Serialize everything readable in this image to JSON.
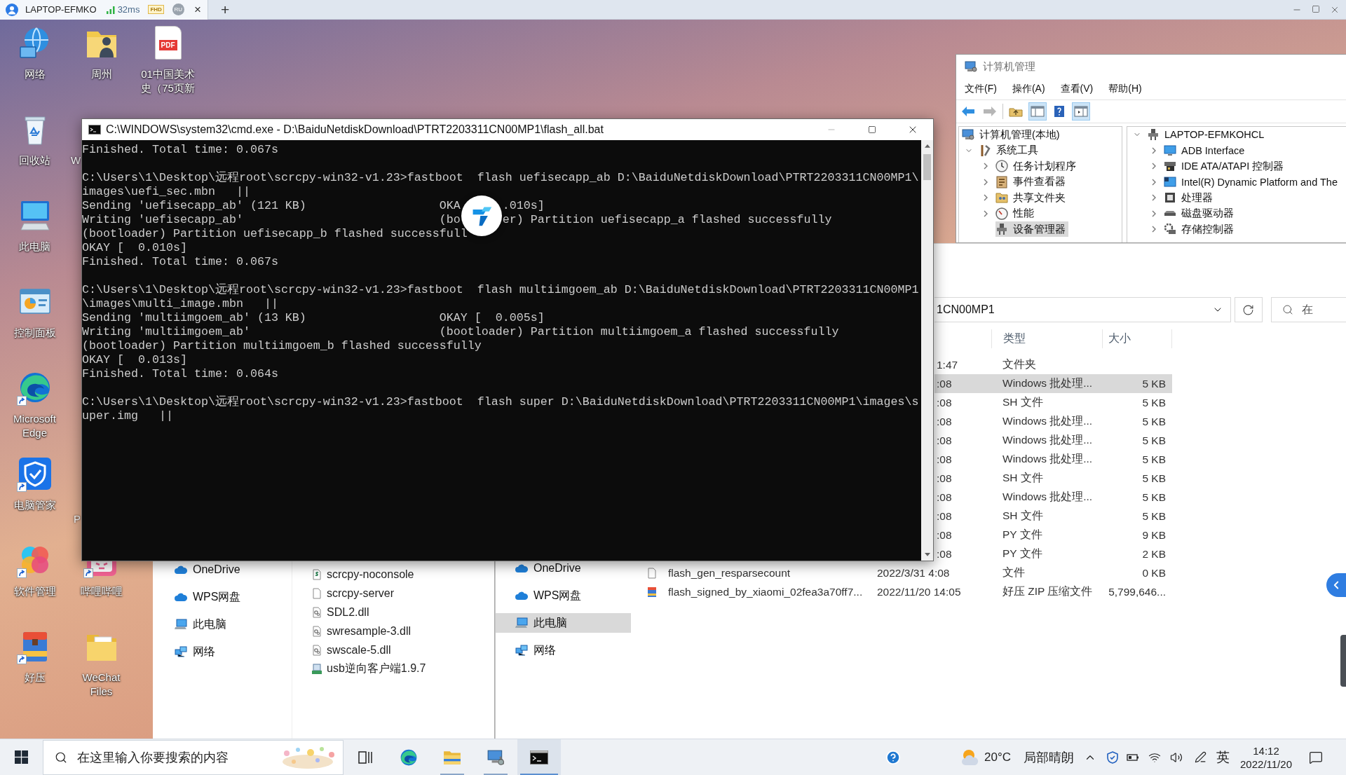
{
  "remote_bar": {
    "tab": {
      "title": "LAPTOP-EFMKO",
      "latency": "32ms",
      "quality": "FHD",
      "user": "RU",
      "close": "×",
      "selected": true
    },
    "new_tab": "+"
  },
  "desktop": {
    "icons": [
      {
        "label": "网络",
        "kind": "network",
        "shortcut": false
      },
      {
        "label": "回收站",
        "kind": "recycle",
        "shortcut": false
      },
      {
        "label": "此电脑",
        "kind": "computer",
        "shortcut": false
      },
      {
        "label": "控制面板",
        "kind": "control",
        "shortcut": false
      },
      {
        "label": "Microsoft Edge",
        "kind": "edge",
        "shortcut": true
      },
      {
        "label": "电脑管家",
        "kind": "shield",
        "shortcut": true
      },
      {
        "label": "软件管理",
        "kind": "apps",
        "shortcut": true
      },
      {
        "label": "好压",
        "kind": "archive",
        "shortcut": true
      },
      {
        "label": "周州",
        "kind": "userfolder",
        "shortcut": false
      },
      {
        "label": "哔哩哔哩",
        "kind": "tv",
        "shortcut": true
      },
      {
        "label": "WeChat Files",
        "kind": "folder",
        "shortcut": false
      },
      {
        "label": "01中国美术史（75页新",
        "kind": "pdf",
        "badge": "PDF",
        "shortcut": false
      }
    ],
    "covered_labels": [
      "W",
      "P"
    ]
  },
  "terminal": {
    "title": "C:\\WINDOWS\\system32\\cmd.exe - D:\\BaiduNetdiskDownload\\PTRT2203311CN00MP1\\flash_all.bat",
    "blocks": [
      [
        [
          "Finished. Total time: 0.067s"
        ]
      ],
      [
        [
          "C:\\Users\\1\\Desktop\\远程root\\scrcpy-win32-v1.23>fastboot  flash uefisecapp_ab D:\\BaiduNetdiskDownload\\PTRT2203311CN00MP1\\"
        ],
        [
          "images\\uefi_sec.mbn   ||"
        ],
        [
          "Sending 'uefisecapp_ab' (121 KB)                   OKA",
          ".010s]"
        ],
        [
          "Writing 'uefisecapp_ab'                            (bo",
          "er) Partition uefisecapp_a flashed successfully"
        ],
        [
          "(bootloader) Partition uefisecapp_b flashed successfull"
        ],
        [
          "OKAY [  0.010s]"
        ],
        [
          "Finished. Total time: 0.067s"
        ]
      ],
      [
        [
          "C:\\Users\\1\\Desktop\\远程root\\scrcpy-win32-v1.23>fastboot  flash multiimgoem_ab D:\\BaiduNetdiskDownload\\PTRT2203311CN00MP1"
        ],
        [
          "\\images\\multi_image.mbn   ||"
        ],
        [
          "Sending 'multiimgoem_ab' (13 KB)                   OKAY [  0.005s]"
        ],
        [
          "Writing 'multiimgoem_ab'                           (bootloader) Partition multiimgoem_a flashed successfully"
        ],
        [
          "(bootloader) Partition multiimgoem_b flashed successfully"
        ],
        [
          "OKAY [  0.013s]"
        ],
        [
          "Finished. Total time: 0.064s"
        ]
      ],
      [
        [
          "C:\\Users\\1\\Desktop\\远程root\\scrcpy-win32-v1.23>fastboot  flash super D:\\BaiduNetdiskDownload\\PTRT2203311CN00MP1\\images\\s"
        ],
        [
          "uper.img   ||"
        ]
      ]
    ]
  },
  "computer_management": {
    "title": "计算机管理",
    "menu": [
      "文件(F)",
      "操作(A)",
      "查看(V)",
      "帮助(H)"
    ],
    "toolbar": [
      {
        "kind": "back",
        "pressed": false,
        "disabled": false
      },
      {
        "kind": "forward",
        "pressed": false,
        "disabled": true
      },
      {
        "kind": "up",
        "pressed": false,
        "disabled": false
      },
      {
        "kind": "tree",
        "pressed": true,
        "disabled": false
      },
      {
        "kind": "help",
        "pressed": false,
        "disabled": false
      },
      {
        "kind": "actions",
        "pressed": true,
        "disabled": false
      }
    ],
    "nav_tree": [
      {
        "label": "计算机管理(本地)",
        "kind": "computer",
        "expandable": false,
        "selected": false,
        "children": [
          {
            "label": "系统工具",
            "kind": "tools",
            "expandable": true,
            "expanded": true,
            "selected": false,
            "children": [
              {
                "label": "任务计划程序",
                "kind": "clock",
                "expandable": true,
                "expanded": false,
                "selected": false
              },
              {
                "label": "事件查看器",
                "kind": "event",
                "expandable": true,
                "expanded": false,
                "selected": false
              },
              {
                "label": "共享文件夹",
                "kind": "share",
                "expandable": true,
                "expanded": false,
                "selected": false
              },
              {
                "label": "性能",
                "kind": "gauge",
                "expandable": true,
                "expanded": false,
                "selected": false
              },
              {
                "label": "设备管理器",
                "kind": "device",
                "expandable": false,
                "selected": true
              }
            ]
          }
        ]
      }
    ],
    "device_tree": [
      {
        "label": "LAPTOP-EFMKOHCL",
        "kind": "device",
        "expandable": true,
        "expanded": true,
        "selected": false,
        "children": [
          {
            "label": "ADB Interface",
            "kind": "monitor",
            "expandable": true,
            "expanded": false,
            "selected": false
          },
          {
            "label": "IDE ATA/ATAPI 控制器",
            "kind": "drive",
            "expandable": true,
            "expanded": false,
            "selected": false
          },
          {
            "label": "Intel(R) Dynamic Platform and The",
            "kind": "panel",
            "expandable": true,
            "expanded": false,
            "selected": false
          },
          {
            "label": "处理器",
            "kind": "chip",
            "expandable": true,
            "expanded": false,
            "selected": false
          },
          {
            "label": "磁盘驱动器",
            "kind": "disk",
            "expandable": true,
            "expanded": false,
            "selected": false
          },
          {
            "label": "存储控制器",
            "kind": "storage",
            "expandable": true,
            "expanded": false,
            "selected": false
          }
        ]
      }
    ]
  },
  "explorer_right": {
    "address": "1CN00MP1",
    "search": {
      "placeholder": "在"
    },
    "columns": [
      "类型",
      "大小"
    ],
    "rows": [
      {
        "kind": "covered",
        "date": "1:47",
        "type": "文件夹",
        "selected": false
      },
      {
        "kind": "covered",
        "date": ":08",
        "type": "Windows 批处理...",
        "size": "5 KB",
        "selected": true
      },
      {
        "kind": "covered",
        "date": ":08",
        "type": "SH 文件",
        "size": "5 KB",
        "selected": false
      },
      {
        "kind": "covered",
        "date": ":08",
        "type": "Windows 批处理...",
        "size": "5 KB",
        "selected": false
      },
      {
        "kind": "covered",
        "date": ":08",
        "type": "Windows 批处理...",
        "size": "5 KB",
        "selected": false
      },
      {
        "kind": "covered",
        "date": ":08",
        "type": "Windows 批处理...",
        "size": "5 KB",
        "selected": false
      },
      {
        "kind": "covered",
        "date": ":08",
        "type": "SH 文件",
        "size": "5 KB",
        "selected": false
      },
      {
        "kind": "covered",
        "date": ":08",
        "type": "Windows 批处理...",
        "size": "5 KB",
        "selected": false
      },
      {
        "kind": "covered",
        "date": ":08",
        "type": "SH 文件",
        "size": "5 KB",
        "selected": false
      },
      {
        "kind": "covered",
        "date": ":08",
        "type": "PY 文件",
        "size": "9 KB",
        "selected": false
      },
      {
        "kind": "covered",
        "date": ":08",
        "type": "PY 文件",
        "size": "2 KB",
        "selected": false
      },
      {
        "kind": "file",
        "name": "flash_gen_resparsecount",
        "date": "2022/3/31 4:08",
        "type": "文件",
        "size": "0 KB",
        "selected": false
      },
      {
        "kind": "archive",
        "name": "flash_signed_by_xiaomi_02fea3a70ff7...",
        "date": "2022/11/20 14:05",
        "type": "好压 ZIP 压缩文件",
        "size": "5,799,646...",
        "selected": false
      }
    ],
    "nav": [
      {
        "label": "OneDrive",
        "kind": "cloud",
        "selected": false
      },
      {
        "label": "WPS网盘",
        "kind": "cloud",
        "selected": false
      },
      {
        "label": "此电脑",
        "kind": "computer",
        "selected": true
      },
      {
        "label": "网络",
        "kind": "network",
        "selected": false
      }
    ]
  },
  "explorer_left": {
    "nav": [
      {
        "label": "OneDrive",
        "kind": "cloud",
        "selected": false
      },
      {
        "label": "WPS网盘",
        "kind": "cloud",
        "selected": false
      },
      {
        "label": "此电脑",
        "kind": "computer",
        "selected": false
      },
      {
        "label": "网络",
        "kind": "network",
        "selected": false
      }
    ],
    "files": [
      {
        "name": "scrcpy-noconsole",
        "kind": "script"
      },
      {
        "name": "scrcpy-server",
        "kind": "blank"
      },
      {
        "name": "SDL2.dll",
        "kind": "dll"
      },
      {
        "name": "swresample-3.dll",
        "kind": "dll"
      },
      {
        "name": "swscale-5.dll",
        "kind": "dll"
      },
      {
        "name": "usb逆向客户端1.9.7",
        "kind": "installer"
      }
    ]
  },
  "taskbar": {
    "search": {
      "placeholder": "在这里输入你要搜索的内容"
    },
    "apps": [
      {
        "kind": "taskview",
        "running": false,
        "selected": false
      },
      {
        "kind": "edge",
        "running": false,
        "selected": false
      },
      {
        "kind": "explorer",
        "running": true,
        "selected": false
      },
      {
        "kind": "management",
        "running": true,
        "selected": false
      },
      {
        "kind": "terminal",
        "running": true,
        "selected": true
      }
    ],
    "weather": {
      "temperature": "20°C",
      "condition": "局部晴朗"
    },
    "input_method": "英",
    "clock": {
      "time": "14:12",
      "date": "2022/11/20"
    }
  }
}
